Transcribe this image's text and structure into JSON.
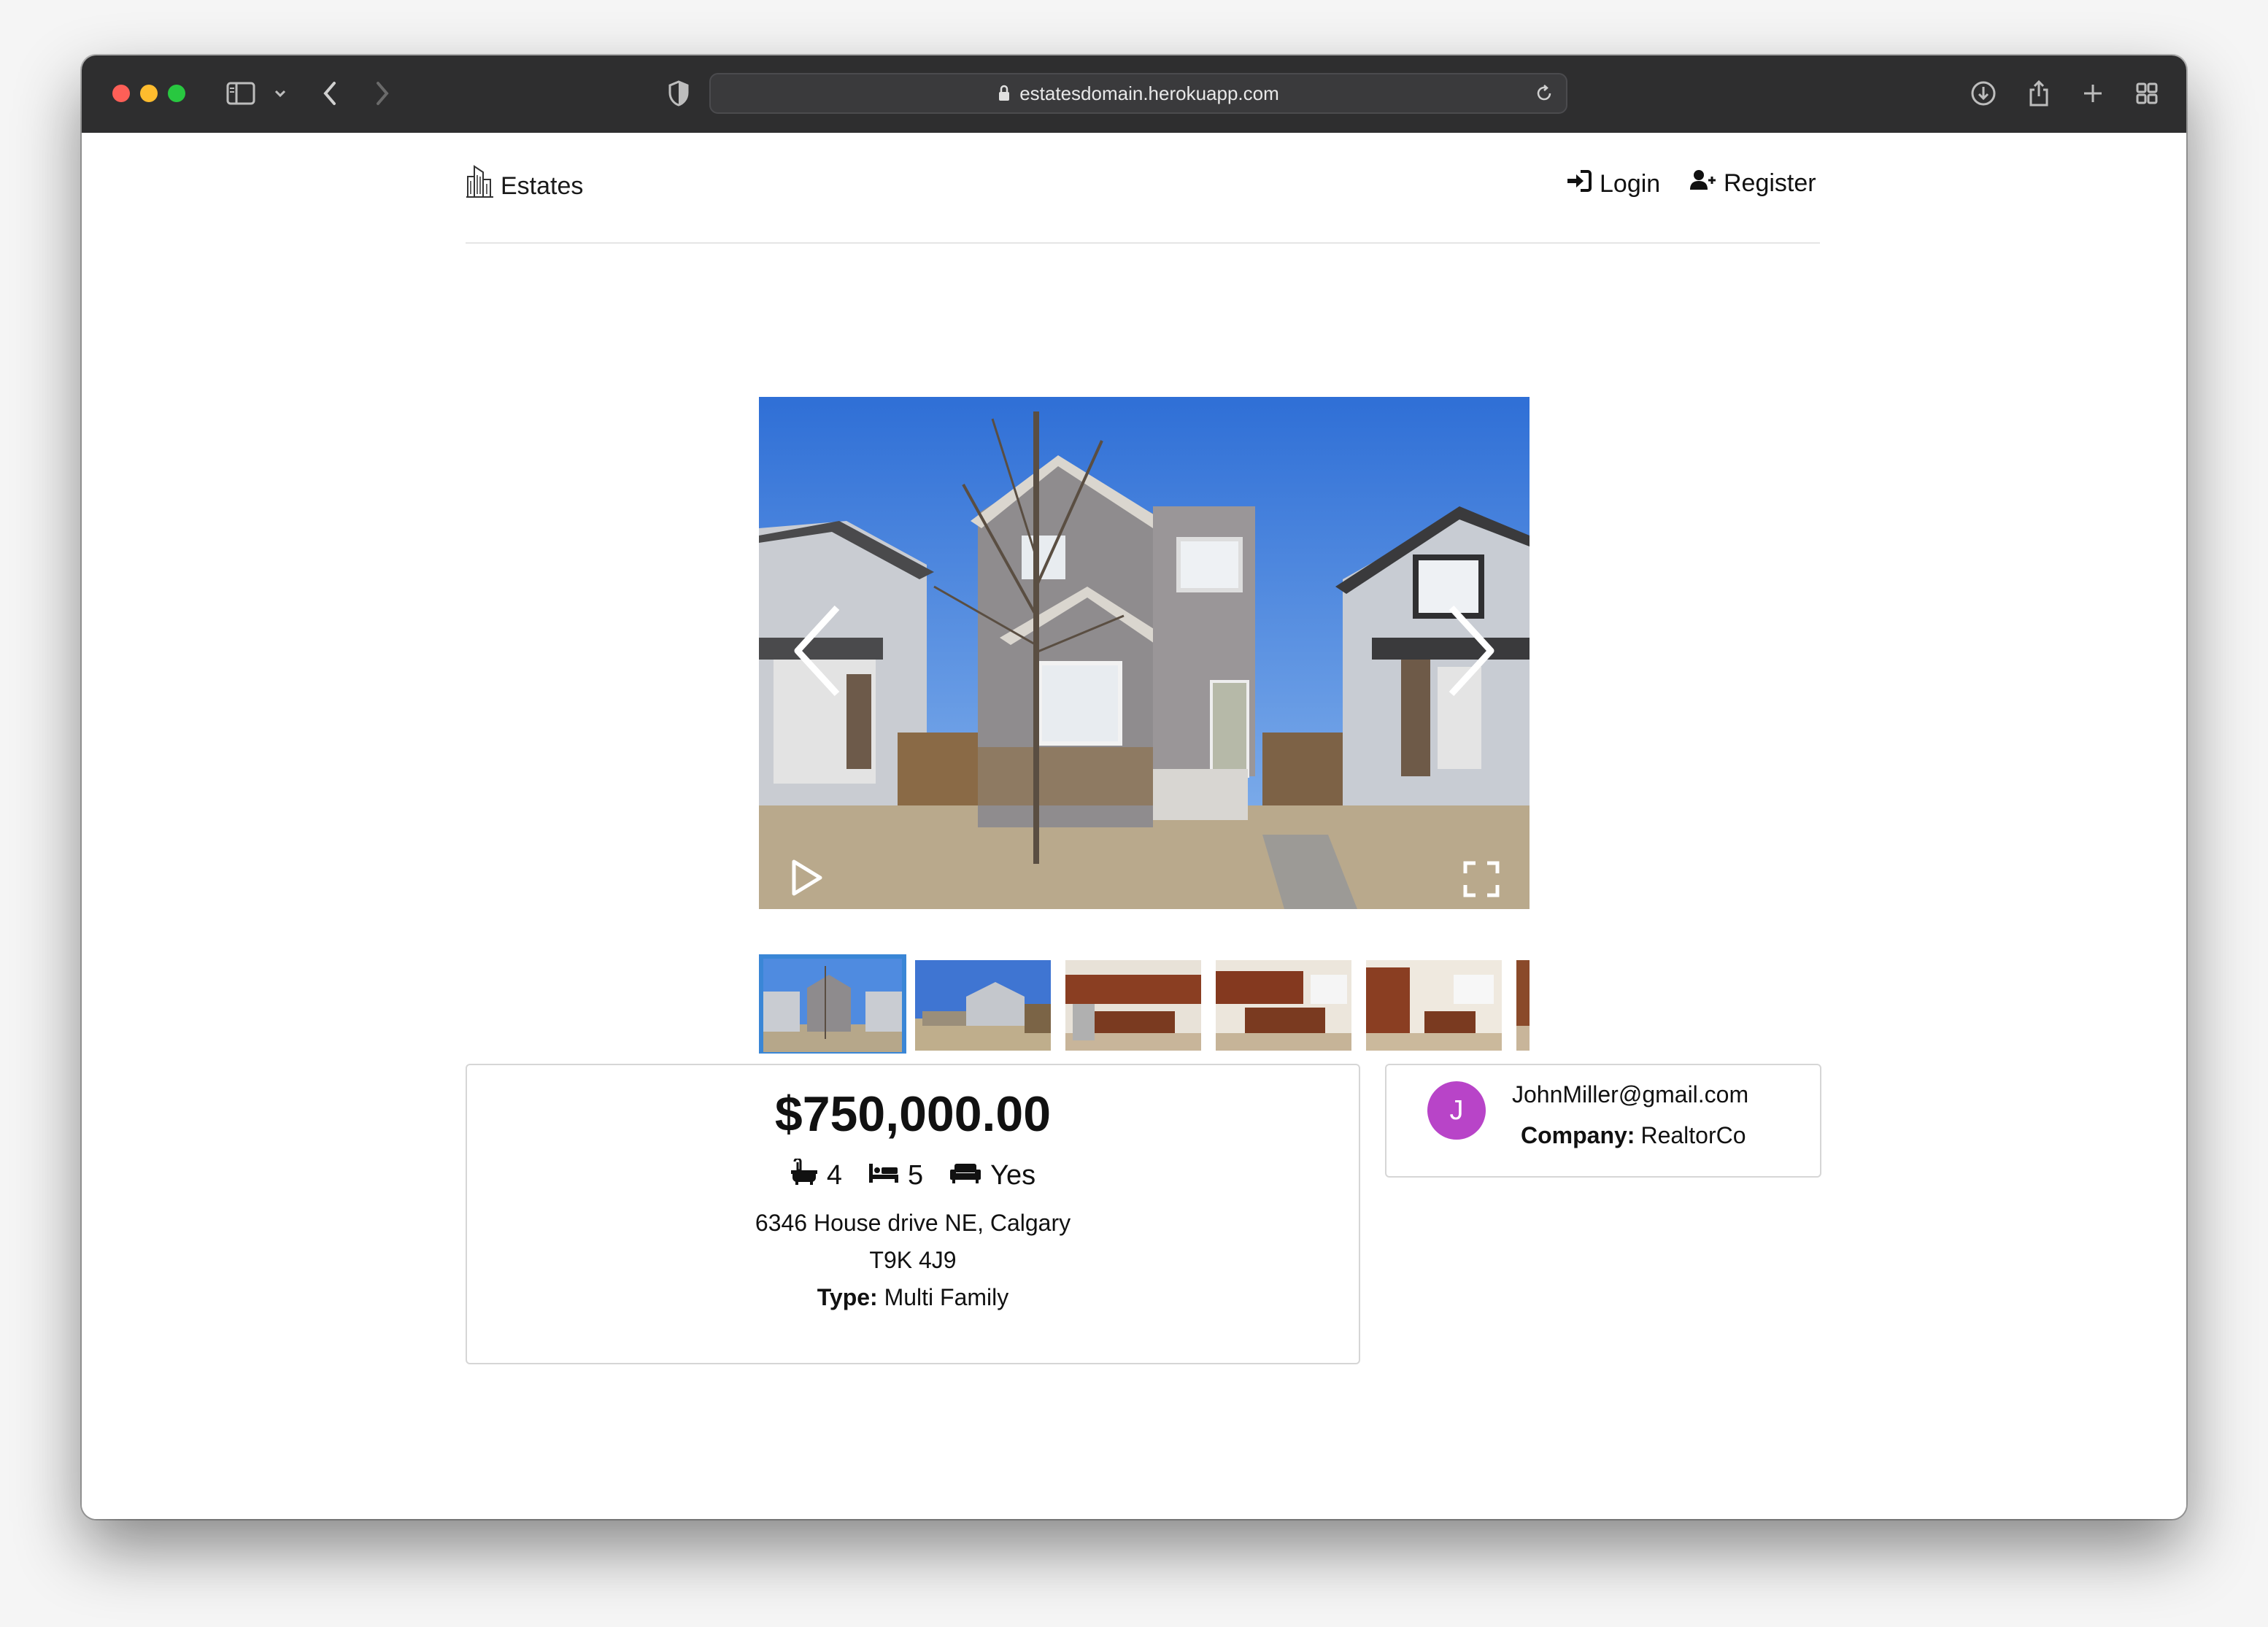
{
  "browser": {
    "url": "estatesdomain.herokuapp.com"
  },
  "nav": {
    "brand": "Estates",
    "login": "Login",
    "register": "Register"
  },
  "gallery": {
    "thumbnail_count": 6
  },
  "listing": {
    "price": "$750,000.00",
    "bathrooms": "4",
    "bedrooms": "5",
    "furnished": "Yes",
    "address_line": "6346 House drive NE, Calgary",
    "postal_code": "T9K 4J9",
    "type_label": "Type:",
    "type_value": "Multi Family"
  },
  "agent": {
    "initial": "J",
    "email": "JohnMiller@gmail.com",
    "company_label": "Company:",
    "company_value": "RealtorCo"
  },
  "colors": {
    "accent": "#3a86d6",
    "avatar": "#b844c8"
  }
}
